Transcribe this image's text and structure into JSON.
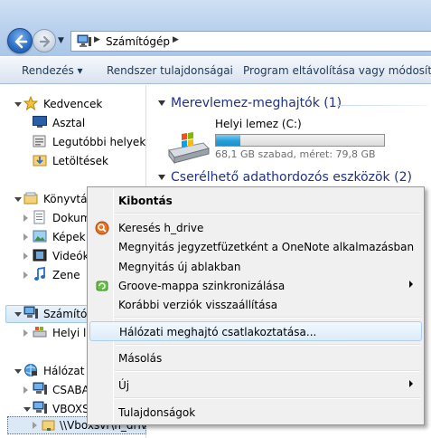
{
  "address": {
    "crumb": "Számítógép",
    "computer_icon": "computer-icon",
    "chevron": "chevron-right-icon"
  },
  "toolbar": {
    "organize": "Rendezés ▾",
    "system_properties": "Rendszer tulajdonságai",
    "uninstall": "Program eltávolítása vagy módosítása"
  },
  "nav": {
    "favorites": "Kedvencek",
    "desktop": "Asztal",
    "recent": "Legutóbbi helyek",
    "downloads": "Letöltések",
    "libraries": "Könyvtár",
    "documents": "Dokum",
    "pictures": "Képek",
    "videos": "Videók",
    "music": "Zene",
    "computer": "Számítóg",
    "local_disk": "Helyi le",
    "network": "Hálózat",
    "csaba": "CSABA",
    "vboxsvr": "VBOXSV",
    "share": "\\\\Vboxsvr\\h_drive"
  },
  "content": {
    "hdd_group": "Merevlemez-meghajtók (1)",
    "removable_group": "Cserélhető adathordozós eszközök (2)",
    "drive_name": "Helyi lemez (C:)",
    "drive_info": "68,1 GB szabad, méret: 79,8 GB",
    "drive_used_fraction": 0.147
  },
  "menu": {
    "open": "Kibontás",
    "search": "Keresés h_drive",
    "onenote": "Megnyitás jegyzetfüzetként a OneNote alkalmazásban",
    "new_window": "Megnyitás új ablakban",
    "groove": "Groove-mappa szinkronizálása",
    "previous": "Korábbi verziók visszaállítása",
    "map_drive": "Hálózati meghajtó csatlakoztatása...",
    "copy": "Másolás",
    "new": "Új",
    "properties": "Tulajdonságok"
  },
  "colors": {
    "group_header": "#1e3287",
    "command_text": "#1e395b",
    "drive_fill": "#26a0da",
    "menu_bg": "#f0f0f0",
    "menu_hover": "#dbecfa"
  }
}
